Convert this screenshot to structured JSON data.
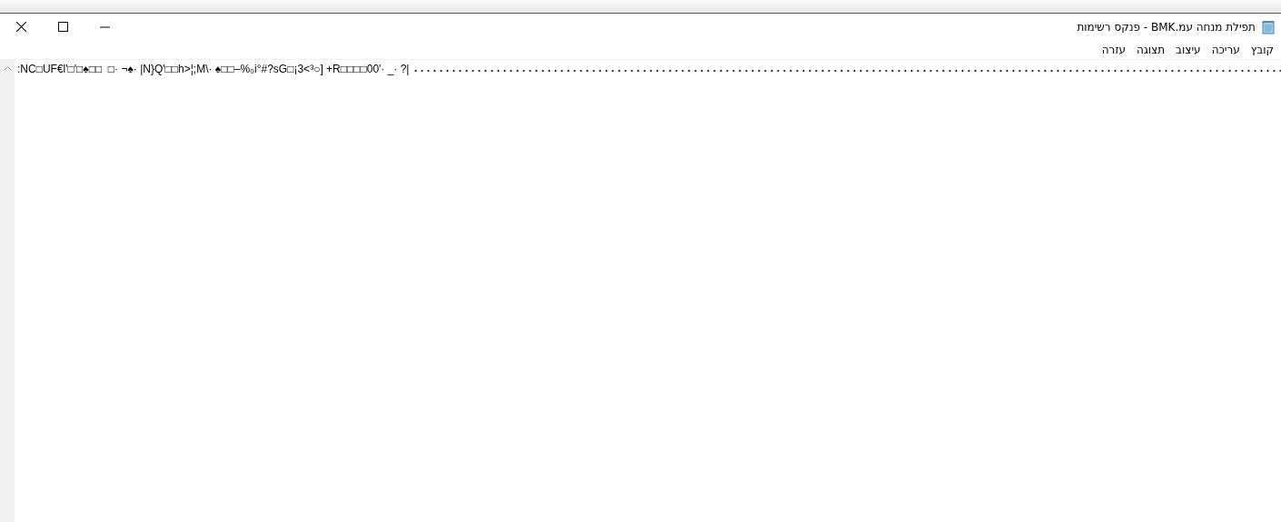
{
  "window": {
    "title": "תפילת מנחה עמ.BMK - פנקס רשימות"
  },
  "menu": [
    {
      "label": "קובץ"
    },
    {
      "label": "עריכה"
    },
    {
      "label": "עיצוב"
    },
    {
      "label": "תצוגה"
    },
    {
      "label": "עזרה"
    }
  ],
  "editor": {
    "line": ":NC□UF€l'□'□♠□□  □· ¬♠· |N}Q'□□h>¦;M\\· ♠□□–%₀i°#?sG□¡3<³○] +R□□□□00'· _· ?|"
  }
}
